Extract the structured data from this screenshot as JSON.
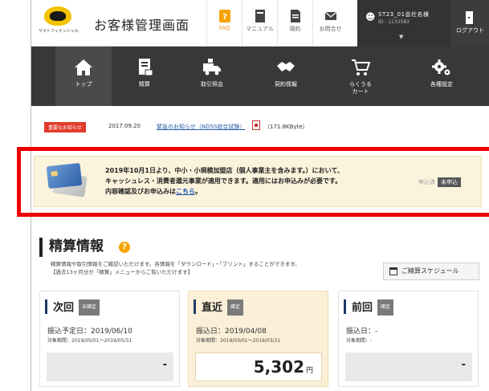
{
  "header": {
    "logo_text": "ヤマトフィナンシャル",
    "title": "お客様管理画面",
    "nav": [
      {
        "label": "FAQ",
        "icon": "faq-icon"
      },
      {
        "label": "マニュアル",
        "icon": "manual-icon"
      },
      {
        "label": "規約",
        "icon": "terms-icon"
      },
      {
        "label": "お問合せ",
        "icon": "mail-icon"
      }
    ],
    "user": {
      "name": "ST23_01会社名様",
      "id": "ID : 1133583"
    },
    "logout_label": "ログアウト"
  },
  "main_nav": [
    {
      "label": "トップ",
      "icon": "home-icon",
      "active": true
    },
    {
      "label": "精算",
      "icon": "document-icon"
    },
    {
      "label": "取引照会",
      "icon": "delivery-truck-icon"
    },
    {
      "label": "契約情報",
      "icon": "handshake-icon"
    },
    {
      "label": "らくうる\nカート",
      "icon": "cart-icon"
    },
    {
      "label": "各種設定",
      "icon": "gear-icon"
    }
  ],
  "notice": {
    "badge": "重要なお知らせ",
    "date": "2017.09.20",
    "link_text": "緊急のお知らせ（NDSS総合試験）",
    "file_size": "（171.8KByte）"
  },
  "banner": {
    "message_line1": "2019年10月1日より、中小・小規模加盟店（個人事業主を含みます。）において、",
    "message_line2": "キャッシュレス・消費者還元事業が適用できます。適用にはお申込みが必要です。",
    "message_line3": "内容確認及びお申込みは",
    "link_text": "こちら",
    "message_end": "。",
    "status_label": "申込済",
    "status_value": "未申込"
  },
  "settlement": {
    "title": "精算情報",
    "desc_line1": "精算情報や取引情報をご確認いただけます。各情報を「ダウンロード」・「プリント」することができます。",
    "desc_line2": "【過去13ヶ月分が「精算」メニューからご覧いただけます】",
    "schedule_button": "ご精算スケジュール",
    "cards": [
      {
        "title": "次回",
        "tag": "未確定",
        "date": "振込予定日：2019/06/10",
        "range": "対象期間：2019/05/01〜2019/05/31",
        "amount": "-"
      },
      {
        "title": "直近",
        "tag": "確定",
        "date": "振込日：2019/04/08",
        "range": "対象期間：2019/03/01〜2019/03/31",
        "amount": "5,302",
        "currency": "円"
      },
      {
        "title": "前回",
        "tag": "確定",
        "date": "振込日：-",
        "range": "対象期間：-",
        "amount": "-"
      }
    ]
  },
  "colors": {
    "nav_bg": "#383838",
    "alert_red": "#ee0000",
    "banner_bg": "#fbf3dc",
    "accent_orange": "#f5a400",
    "card_accent": "#1d3a66"
  }
}
